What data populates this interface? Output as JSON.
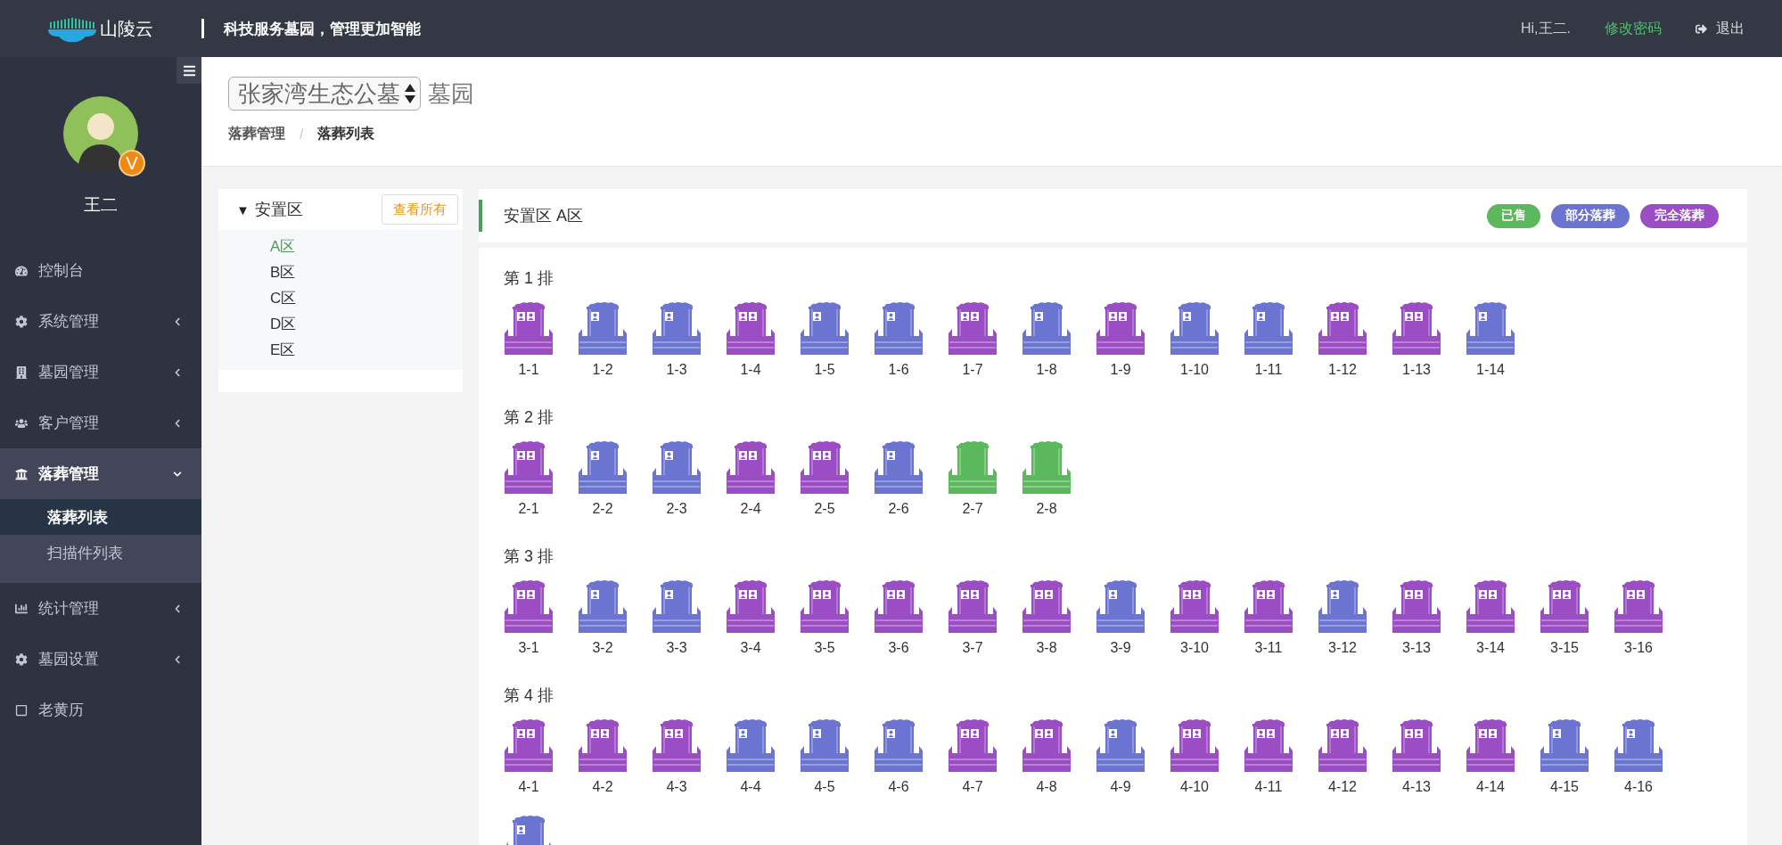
{
  "header": {
    "logo_text": "山陵云",
    "slogan": "科技服务墓园，管理更加智能",
    "greeting": "Hi,王二.",
    "change_password": "修改密码",
    "logout": "退出"
  },
  "sidebar": {
    "user_name": "王二",
    "badge": "V",
    "menu": [
      {
        "label": "控制台",
        "expanded": false,
        "has_arrow": false
      },
      {
        "label": "系统管理",
        "expanded": false,
        "has_arrow": true
      },
      {
        "label": "墓园管理",
        "expanded": false,
        "has_arrow": true
      },
      {
        "label": "客户管理",
        "expanded": false,
        "has_arrow": true
      },
      {
        "label": "落葬管理",
        "expanded": true,
        "has_arrow": true,
        "children": [
          {
            "label": "落葬列表",
            "selected": true
          },
          {
            "label": "扫描件列表",
            "selected": false
          }
        ]
      },
      {
        "label": "统计管理",
        "expanded": false,
        "has_arrow": true
      },
      {
        "label": "墓园设置",
        "expanded": false,
        "has_arrow": true
      },
      {
        "label": "老黄历",
        "expanded": false,
        "has_arrow": false
      }
    ]
  },
  "page_header": {
    "cemetery_select": "张家湾生态公墓",
    "suffix": "墓园",
    "breadcrumb": [
      "落葬管理",
      "落葬列表"
    ],
    "breadcrumb_separator": "/"
  },
  "tree": {
    "toggle": "▼",
    "root": "安置区",
    "expanded": true,
    "view_all": "查看所有",
    "zones": [
      {
        "label": "A区",
        "selected": true
      },
      {
        "label": "B区",
        "selected": false
      },
      {
        "label": "C区",
        "selected": false
      },
      {
        "label": "D区",
        "selected": false
      },
      {
        "label": "E区",
        "selected": false
      }
    ]
  },
  "zone": {
    "title": "安置区 A区",
    "legend": [
      {
        "kind": "sold",
        "label": "已售",
        "color": "#5cb85c"
      },
      {
        "kind": "partial",
        "label": "部分落葬",
        "color": "#6b74d0"
      },
      {
        "kind": "full",
        "label": "完全落葬",
        "color": "#9b4dc4"
      }
    ]
  },
  "rows": [
    {
      "title": "第 1 排",
      "graves": [
        {
          "label": "1-1",
          "kind": "full"
        },
        {
          "label": "1-2",
          "kind": "partial"
        },
        {
          "label": "1-3",
          "kind": "partial"
        },
        {
          "label": "1-4",
          "kind": "full"
        },
        {
          "label": "1-5",
          "kind": "partial"
        },
        {
          "label": "1-6",
          "kind": "partial"
        },
        {
          "label": "1-7",
          "kind": "full"
        },
        {
          "label": "1-8",
          "kind": "partial"
        },
        {
          "label": "1-9",
          "kind": "full"
        },
        {
          "label": "1-10",
          "kind": "partial"
        },
        {
          "label": "1-11",
          "kind": "partial"
        },
        {
          "label": "1-12",
          "kind": "full"
        },
        {
          "label": "1-13",
          "kind": "full"
        },
        {
          "label": "1-14",
          "kind": "partial"
        }
      ]
    },
    {
      "title": "第 2 排",
      "graves": [
        {
          "label": "2-1",
          "kind": "full"
        },
        {
          "label": "2-2",
          "kind": "partial"
        },
        {
          "label": "2-3",
          "kind": "partial"
        },
        {
          "label": "2-4",
          "kind": "full"
        },
        {
          "label": "2-5",
          "kind": "full"
        },
        {
          "label": "2-6",
          "kind": "partial"
        },
        {
          "label": "2-7",
          "kind": "sold"
        },
        {
          "label": "2-8",
          "kind": "sold"
        }
      ]
    },
    {
      "title": "第 3 排",
      "graves": [
        {
          "label": "3-1",
          "kind": "full"
        },
        {
          "label": "3-2",
          "kind": "partial"
        },
        {
          "label": "3-3",
          "kind": "partial"
        },
        {
          "label": "3-4",
          "kind": "full"
        },
        {
          "label": "3-5",
          "kind": "full"
        },
        {
          "label": "3-6",
          "kind": "full"
        },
        {
          "label": "3-7",
          "kind": "full"
        },
        {
          "label": "3-8",
          "kind": "full"
        },
        {
          "label": "3-9",
          "kind": "partial"
        },
        {
          "label": "3-10",
          "kind": "full"
        },
        {
          "label": "3-11",
          "kind": "full"
        },
        {
          "label": "3-12",
          "kind": "partial"
        },
        {
          "label": "3-13",
          "kind": "full"
        },
        {
          "label": "3-14",
          "kind": "full"
        },
        {
          "label": "3-15",
          "kind": "full"
        },
        {
          "label": "3-16",
          "kind": "full"
        }
      ]
    },
    {
      "title": "第 4 排",
      "graves": [
        {
          "label": "4-1",
          "kind": "full"
        },
        {
          "label": "4-2",
          "kind": "full"
        },
        {
          "label": "4-3",
          "kind": "full"
        },
        {
          "label": "4-4",
          "kind": "partial"
        },
        {
          "label": "4-5",
          "kind": "partial"
        },
        {
          "label": "4-6",
          "kind": "partial"
        },
        {
          "label": "4-7",
          "kind": "full"
        },
        {
          "label": "4-8",
          "kind": "full"
        },
        {
          "label": "4-9",
          "kind": "partial"
        },
        {
          "label": "4-10",
          "kind": "full"
        },
        {
          "label": "4-11",
          "kind": "full"
        },
        {
          "label": "4-12",
          "kind": "full"
        },
        {
          "label": "4-13",
          "kind": "full"
        },
        {
          "label": "4-14",
          "kind": "full"
        },
        {
          "label": "4-15",
          "kind": "partial"
        },
        {
          "label": "4-16",
          "kind": "partial"
        },
        {
          "kind": "partial"
        }
      ]
    }
  ]
}
